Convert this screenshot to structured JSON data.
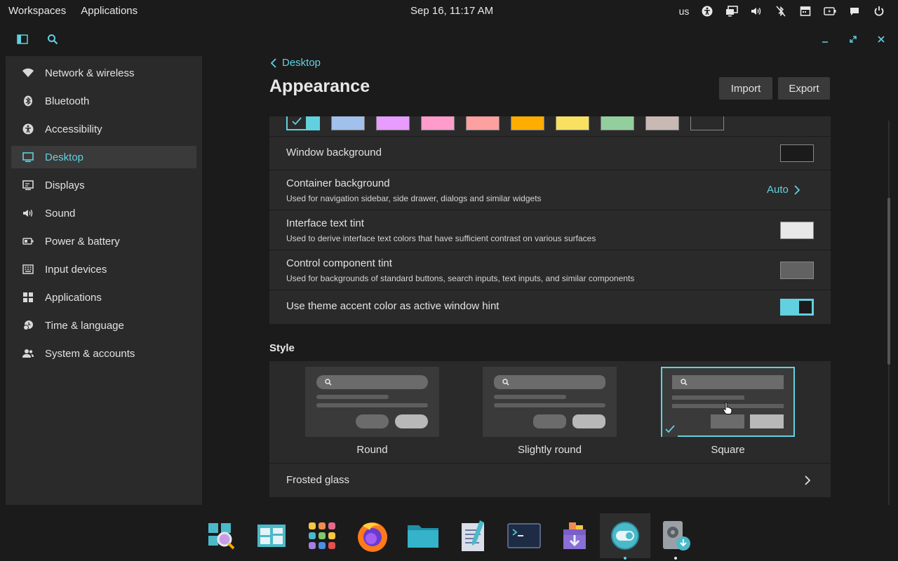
{
  "panel": {
    "workspaces": "Workspaces",
    "applications": "Applications",
    "clock": "Sep 16, 11:17 AM",
    "keyboard_layout": "us",
    "tray_icons": [
      "accessibility-icon",
      "display-icon",
      "volume-icon",
      "bluetooth-off-icon",
      "calendar-icon",
      "battery-icon",
      "notification-icon",
      "power-icon"
    ]
  },
  "sidebar": {
    "items": [
      {
        "label": "Network & wireless",
        "icon": "wifi-icon"
      },
      {
        "label": "Bluetooth",
        "icon": "bluetooth-icon"
      },
      {
        "label": "Accessibility",
        "icon": "accessibility-icon"
      },
      {
        "label": "Desktop",
        "icon": "desktop-icon",
        "active": true
      },
      {
        "label": "Displays",
        "icon": "displays-icon"
      },
      {
        "label": "Sound",
        "icon": "sound-icon"
      },
      {
        "label": "Power & battery",
        "icon": "battery-icon"
      },
      {
        "label": "Input devices",
        "icon": "keyboard-icon"
      },
      {
        "label": "Applications",
        "icon": "apps-grid-icon"
      },
      {
        "label": "Time & language",
        "icon": "clock-globe-icon"
      },
      {
        "label": "System & accounts",
        "icon": "users-icon"
      }
    ]
  },
  "page": {
    "breadcrumb": "Desktop",
    "title": "Appearance",
    "import_label": "Import",
    "export_label": "Export"
  },
  "accent_colors": [
    "#63d0df",
    "#a1c0eb",
    "#e79cfe",
    "#ff9ccc",
    "#fda1a0",
    "#ffad00",
    "#f7e062",
    "#92cf9c",
    "#c8b9b4"
  ],
  "settings": {
    "window_background": {
      "label": "Window background",
      "color": "#1b1b1b"
    },
    "container_background": {
      "label": "Container background",
      "desc": "Used for navigation sidebar, side drawer, dialogs and similar widgets",
      "value": "Auto"
    },
    "interface_text_tint": {
      "label": "Interface text tint",
      "desc": "Used to derive interface text colors that have sufficient contrast on various surfaces",
      "color": "#e8e8e8"
    },
    "control_component_tint": {
      "label": "Control component tint",
      "desc": "Used for backgrounds of standard buttons, search inputs, text inputs, and similar components",
      "color": "#626262"
    },
    "accent_hint": {
      "label": "Use theme accent color as active window hint",
      "enabled": true
    }
  },
  "style": {
    "title": "Style",
    "options": [
      {
        "label": "Round",
        "selected": false
      },
      {
        "label": "Slightly round",
        "selected": false
      },
      {
        "label": "Square",
        "selected": true
      }
    ],
    "frosted_glass": "Frosted glass"
  },
  "dock": {
    "apps": [
      "app-library-icon",
      "workspaces-icon",
      "applications-grid-icon",
      "firefox-icon",
      "files-icon",
      "text-editor-icon",
      "terminal-icon",
      "app-store-icon",
      "settings-icon",
      "installer-icon"
    ]
  },
  "colors": {
    "accent": "#63d0df",
    "background": "#1b1b1b",
    "surface": "#2a2a2a"
  }
}
